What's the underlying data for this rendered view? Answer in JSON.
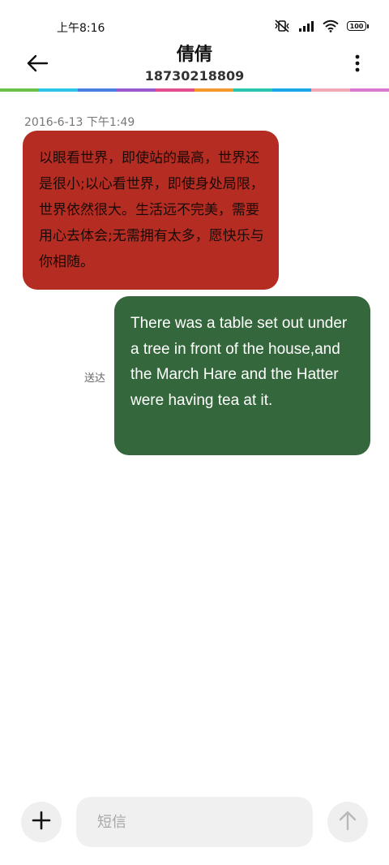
{
  "status_bar": {
    "time": "上午8:16",
    "battery": "100",
    "icons": [
      "mute-vibrate-icon",
      "signal-icon",
      "wifi-icon",
      "battery-icon"
    ]
  },
  "header": {
    "back_icon": "back-arrow-icon",
    "contact_name": "倩倩",
    "contact_number": "18730218809",
    "more_icon": "more-vertical-icon"
  },
  "rainbow_colors": [
    "#6cc04a",
    "#2ec4e8",
    "#4a7ee0",
    "#9b59d0",
    "#e14d8e",
    "#f39a2b",
    "#2bc4b1",
    "#1aa6e8",
    "#f1a9b8",
    "#d97ad0"
  ],
  "conversation": {
    "timestamp": "2016-6-13 下午1:49",
    "messages": [
      {
        "direction": "incoming",
        "text": "以眼看世界，即使站的最高，世界还是很小;以心看世界，即使身处局限，世界依然很大。生活远不完美，需要用心去体会;无需拥有太多，愿快乐与你相随。",
        "bubble_color": "#b52d22"
      },
      {
        "direction": "outgoing",
        "text": "There was a table set out under a tree in front of the house,and the March Hare and the Hatter were having tea at it.",
        "bubble_color": "#34673b",
        "status": "送达"
      }
    ]
  },
  "composer": {
    "add_icon": "plus-icon",
    "placeholder": "短信",
    "send_icon": "send-arrow-up-icon"
  }
}
